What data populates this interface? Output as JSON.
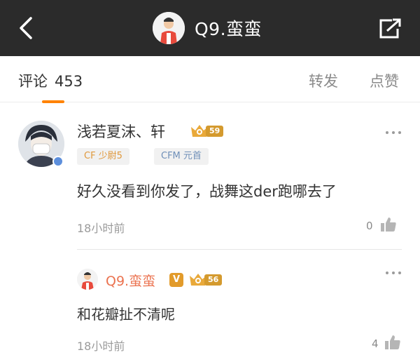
{
  "header": {
    "title": "Q9.蛮蛮",
    "back_icon": "chevron-left-icon",
    "share_icon": "share-icon",
    "background": "#2b2b2b"
  },
  "tabs": {
    "comments_label": "评论",
    "comments_count": "453",
    "repost_label": "转发",
    "like_label": "点赞",
    "accent": "#ff8200"
  },
  "comment": {
    "username": "浅若夏沫、轩",
    "level": "59",
    "gender_icon": "male-icon",
    "tags": [
      "CF 少尉5",
      "CFM 元首"
    ],
    "text": "好久没看到你发了，战舞这der跑哪去了",
    "time": "18小时前",
    "likes": "0"
  },
  "reply": {
    "username": "Q9.蛮蛮",
    "verified_label": "V",
    "level": "56",
    "text": "和花瓣扯不清呢",
    "time": "18小时前",
    "likes": "4"
  }
}
